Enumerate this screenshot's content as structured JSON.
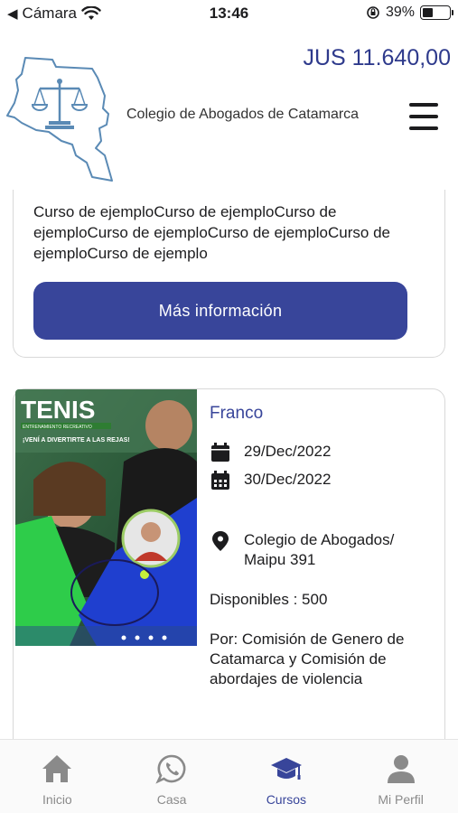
{
  "status_bar": {
    "carrier": "Cámara",
    "time": "13:46",
    "battery": "39%",
    "battery_level": 0.39
  },
  "header": {
    "balance": "JUS 11.640,00",
    "org_name": "Colegio de Abogados de Catamarca"
  },
  "course_card_prev": {
    "description": "Curso de ejemploCurso de ejemploCurso de ejemploCurso de ejemploCurso de ejemploCurso de ejemploCurso de ejemplo",
    "more_button": "Más información"
  },
  "course_card": {
    "teacher": "Franco",
    "start_date": "29/Dec/2022",
    "end_date": "30/Dec/2022",
    "location": "Colegio de Abogados/ Maipu 391",
    "availability": "Disponibles : 500",
    "organizer": "Por: Comisión de Genero de Catamarca y Comisión de abordajes de violencia",
    "image_title": "TENIS",
    "image_subtitle": "ENTRENAMIENTO RECREATIVO",
    "image_tagline": "¡VENÍ A DIVERTIRTE A LAS REJAS!"
  },
  "tabbar": {
    "tabs": [
      {
        "label": "Inicio",
        "icon": "home-icon"
      },
      {
        "label": "Casa",
        "icon": "whatsapp-icon"
      },
      {
        "label": "Cursos",
        "icon": "graduation-cap-icon"
      },
      {
        "label": "Mi Perfil",
        "icon": "user-icon"
      }
    ],
    "active_index": 2
  },
  "colors": {
    "primary": "#38459a",
    "balance": "#2e3a8c",
    "tab_inactive": "#8a8a8a",
    "logo": "#5a8ab5"
  }
}
